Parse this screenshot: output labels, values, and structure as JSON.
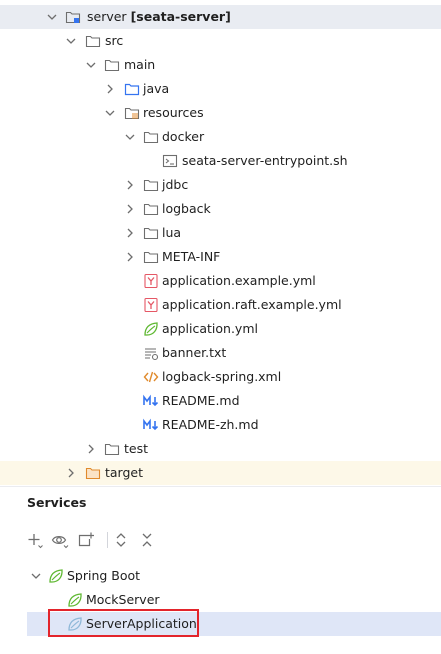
{
  "project_tree": {
    "module": {
      "name": "server",
      "qualifier": "[seata-server]"
    },
    "src": "src",
    "main": "main",
    "java": "java",
    "resources": "resources",
    "docker": "docker",
    "docker_file": "seata-server-entrypoint.sh",
    "jdbc": "jdbc",
    "logback": "logback",
    "lua": "lua",
    "meta_inf": "META-INF",
    "files": [
      "application.example.yml",
      "application.raft.example.yml",
      "application.yml",
      "banner.txt",
      "logback-spring.xml",
      "README.md",
      "README-zh.md"
    ],
    "test": "test",
    "target": "target"
  },
  "services": {
    "title": "Services",
    "toolbar_icons": [
      "add-icon",
      "eye-icon",
      "new-group-icon",
      "expand-all-icon",
      "collapse-all-icon"
    ],
    "tree": {
      "group": "Spring Boot",
      "items": [
        "MockServer",
        "ServerApplication"
      ]
    }
  },
  "colors": {
    "folder_stroke": "#6e6e6e",
    "source_folder": "#3574f0",
    "yaml_red": "#e55765",
    "spring_green": "#5fb832",
    "xml_orange": "#e08a2c",
    "md_blue": "#3574f0",
    "selected_row": "#e9ecf2",
    "highlight_row": "#fdf8e8",
    "selected_service": "#dfe6f7",
    "red_box": "#e3242b"
  }
}
